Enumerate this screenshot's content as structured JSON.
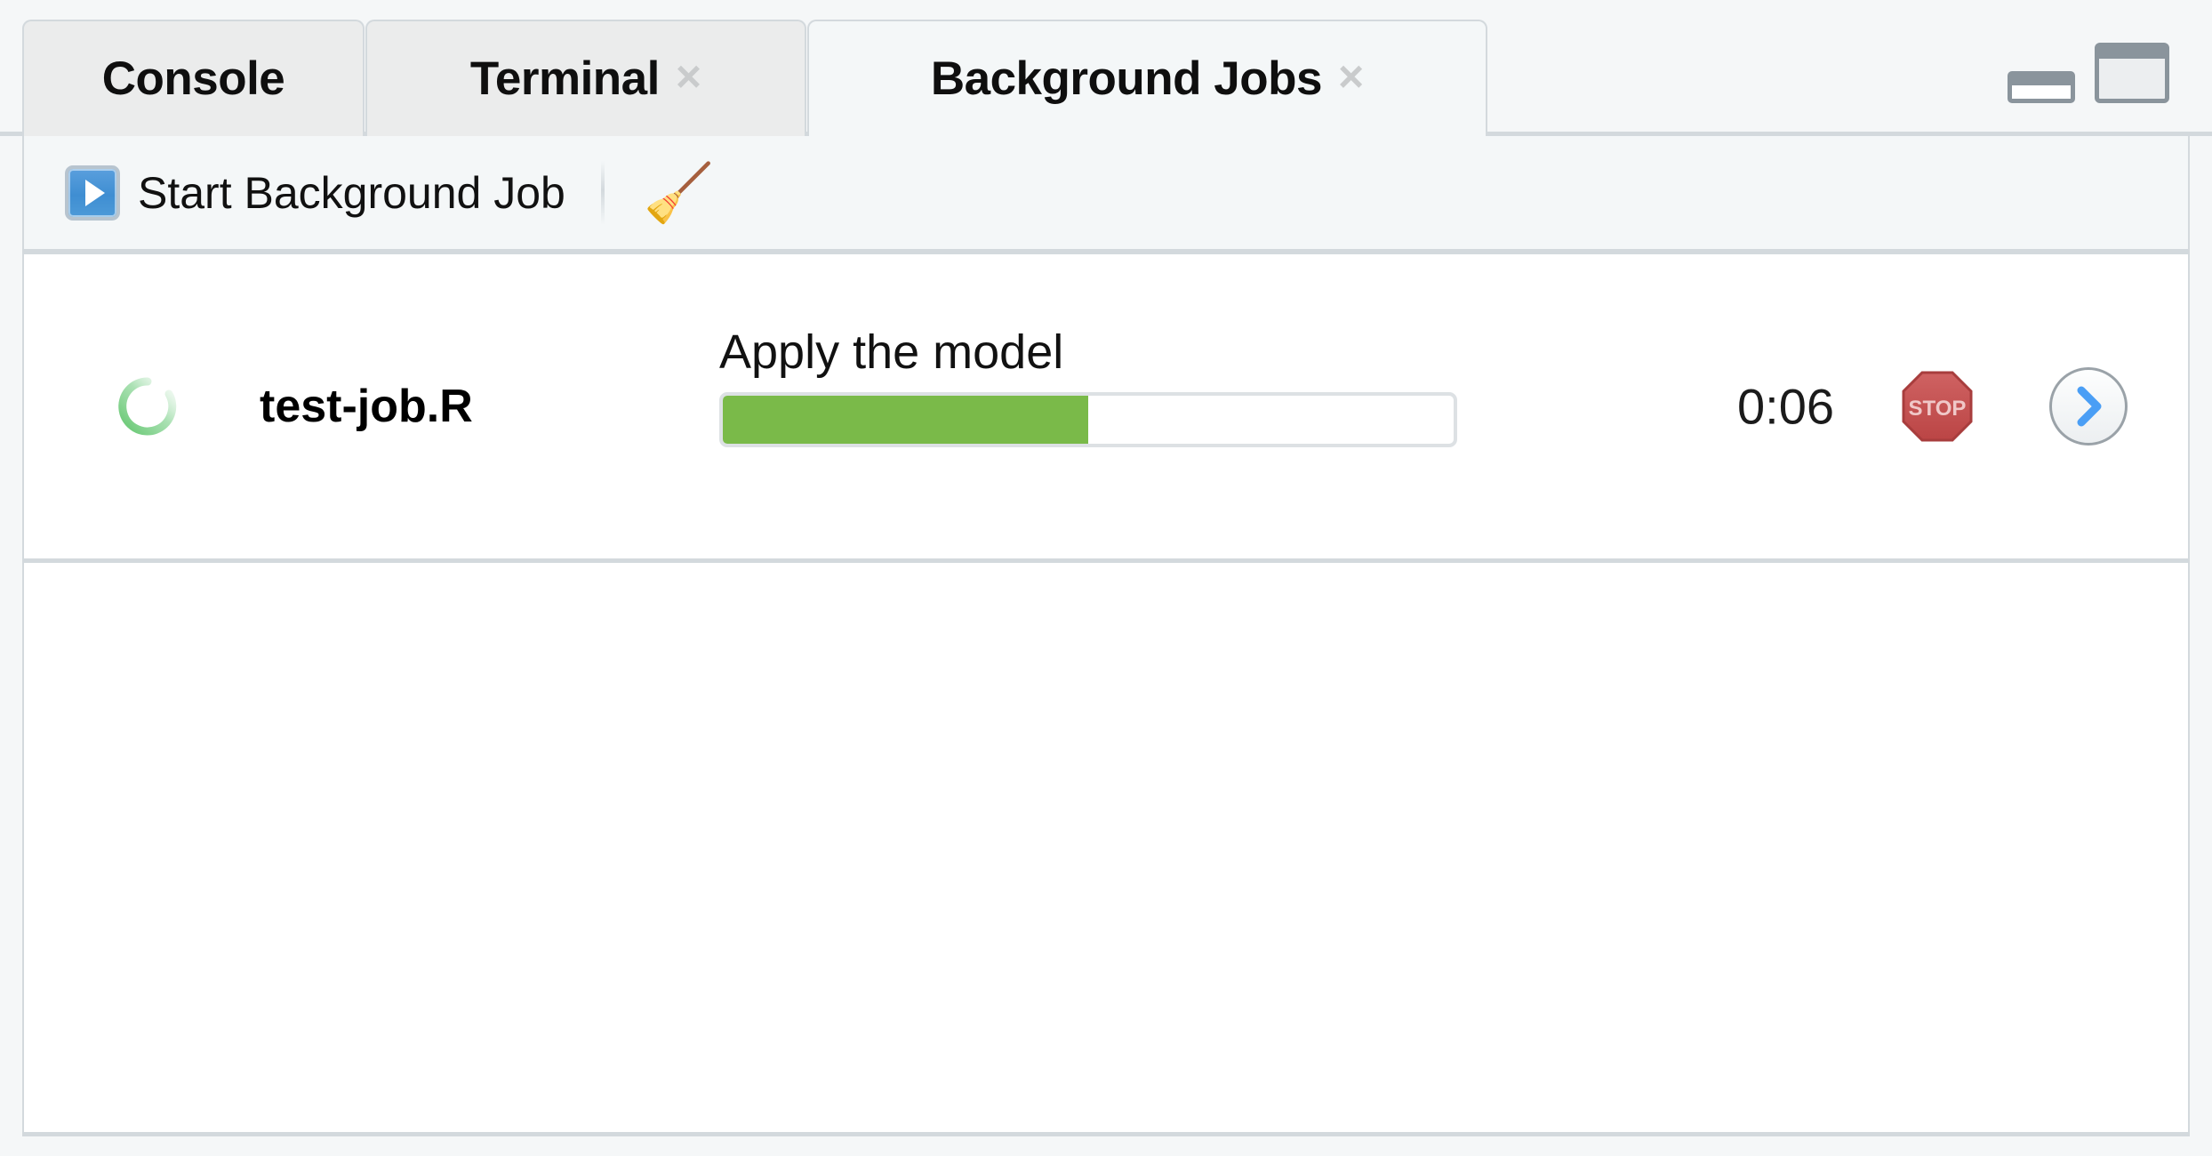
{
  "window": {
    "minimize_icon": "minimize-pane-icon",
    "maximize_icon": "maximize-pane-icon"
  },
  "tabs": [
    {
      "label": "Console",
      "closable": false,
      "active": false,
      "close_label": ""
    },
    {
      "label": "Terminal",
      "closable": true,
      "active": false,
      "close_label": "×"
    },
    {
      "label": "Background Jobs",
      "closable": true,
      "active": true,
      "close_label": "×"
    }
  ],
  "toolbar": {
    "start_job_label": "Start Background Job",
    "start_job_icon": "play-icon",
    "clear_icon": "broom-icon",
    "clear_glyph": "🧹"
  },
  "jobs": [
    {
      "status_icon": "spinner-icon",
      "status": "running",
      "name": "test-job.R",
      "progress_label": "Apply the model",
      "progress_percent": 50,
      "elapsed": "0:06",
      "stop_icon": "stop-icon",
      "stop_glyph": "STOP",
      "open_icon": "chevron-right-icon"
    }
  ],
  "colors": {
    "progress_fill": "#7ABA49",
    "spinner": "#63c66e",
    "stop_red": "#c75050",
    "chevron_blue": "#4a9ef5",
    "border": "#d3d9dd",
    "toolbar_bg": "#f4f7f8",
    "tab_inactive_bg": "#ebecec"
  }
}
